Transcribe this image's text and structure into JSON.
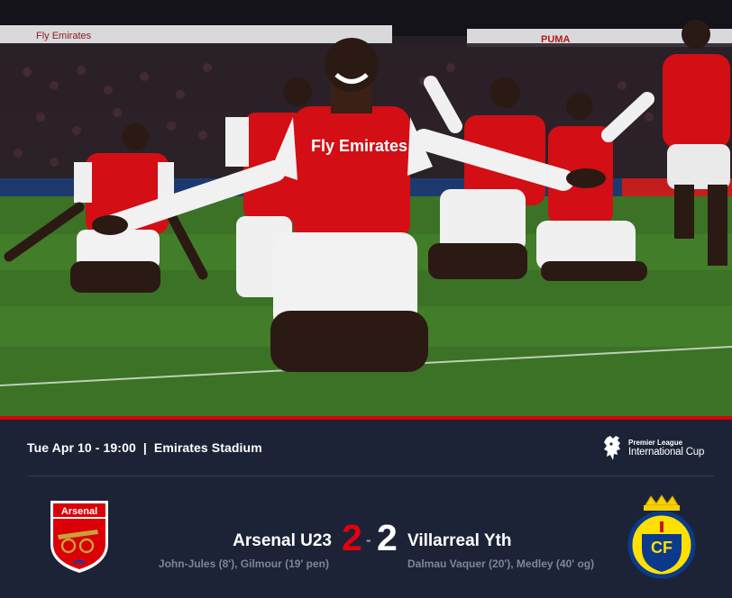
{
  "hero": {
    "board_text_left": "Fly Emirates",
    "board_text_right": "PUMA",
    "shirt_sponsor": "Fly Emirates"
  },
  "match": {
    "date_time": "Tue Apr 10 - 19:00",
    "separator": "|",
    "venue": "Emirates Stadium",
    "competition": {
      "line1": "Premier League",
      "line2": "International Cup",
      "icon": "premier-league-lion-icon"
    },
    "home": {
      "name": "Arsenal U23",
      "score": "2",
      "scorers": "John-Jules (8'), Gilmour (19' pen)",
      "crest_text": "Arsenal",
      "crest_icon": "arsenal-crest-icon"
    },
    "score_separator": "-",
    "away": {
      "name": "Villarreal Yth",
      "score": "2",
      "scorers": "Dalmau Vaquer (20'), Medley (40' og)",
      "crest_text": "CF",
      "crest_icon": "villarreal-crest-icon"
    }
  },
  "colors": {
    "panel_bg": "#1c2336",
    "accent_red": "#db0007",
    "home_score": "#e3000f",
    "away_score": "#ffffff",
    "scorer_text": "#7d8599"
  }
}
